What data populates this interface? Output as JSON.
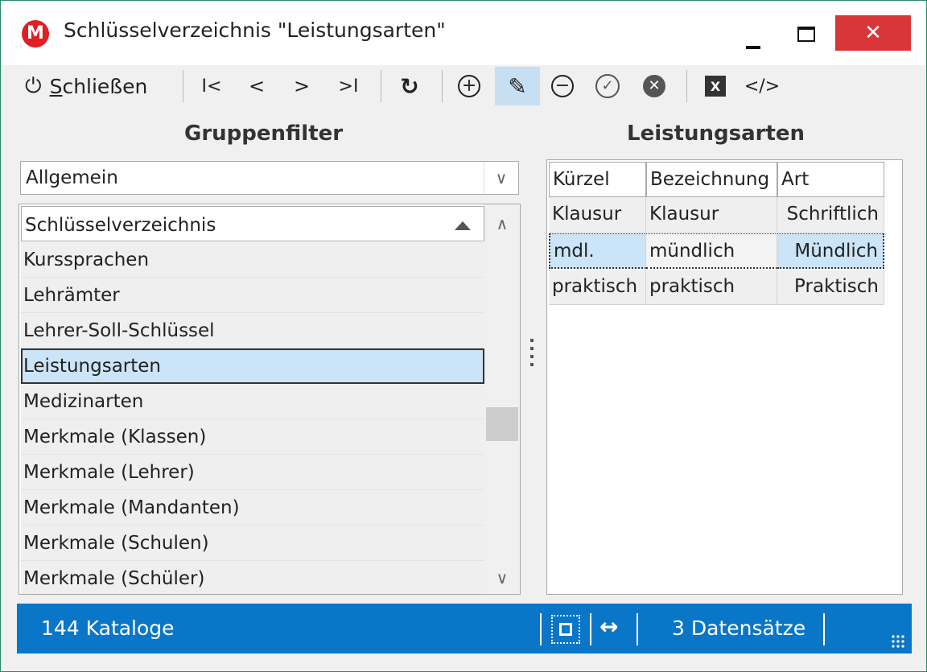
{
  "window": {
    "title": "Schlüsselverzeichnis \"Leistungsarten\"",
    "app_icon_letter": "M",
    "minimize_icon": "minimize-icon",
    "maximize_icon": "maximize-icon",
    "close_glyph": "✕"
  },
  "toolbar": {
    "close_label": "Schließen",
    "power_icon": "⏻",
    "first_glyph": "I<",
    "prev_glyph": "<",
    "next_glyph": ">",
    "last_glyph": ">I",
    "refresh_glyph": "↻",
    "add_glyph": "+",
    "edit_glyph": "✎",
    "remove_glyph": "−",
    "confirm_glyph": "✓",
    "cancel_glyph": "✕",
    "excel_glyph": "X",
    "code_glyph": "</>"
  },
  "left_panel": {
    "heading": "Gruppenfilter",
    "group_select": {
      "value": "Allgemein",
      "arrow": "∨"
    },
    "list_header": "Schlüsselverzeichnis",
    "items": [
      "Kurssprachen",
      "Lehrämter",
      "Lehrer-Soll-Schlüssel",
      "Leistungsarten",
      "Medizinarten",
      "Merkmale (Klassen)",
      "Merkmale (Lehrer)",
      "Merkmale (Mandanten)",
      "Merkmale (Schulen)",
      "Merkmale (Schüler)"
    ],
    "selected_index": 3,
    "scroll_up": "∧",
    "scroll_down": "∨"
  },
  "right_panel": {
    "heading": "Leistungsarten",
    "columns": [
      "Kürzel",
      "Bezeichnung",
      "Art"
    ],
    "rows": [
      [
        "Klausur",
        "Klausur",
        "Schriftlich"
      ],
      [
        "mdl.",
        "mündlich",
        "Mündlich"
      ],
      [
        "praktisch",
        "praktisch",
        "Praktisch"
      ]
    ],
    "focused_row": 1
  },
  "statusbar": {
    "left_text": "144 Kataloge",
    "width_glyph": "↔",
    "right_text": "3 Datensätze"
  },
  "colors": {
    "statusbar": "#0a76c8",
    "selection": "#cce4f7",
    "close_button": "#d9363a",
    "app_icon": "#e01e24"
  }
}
